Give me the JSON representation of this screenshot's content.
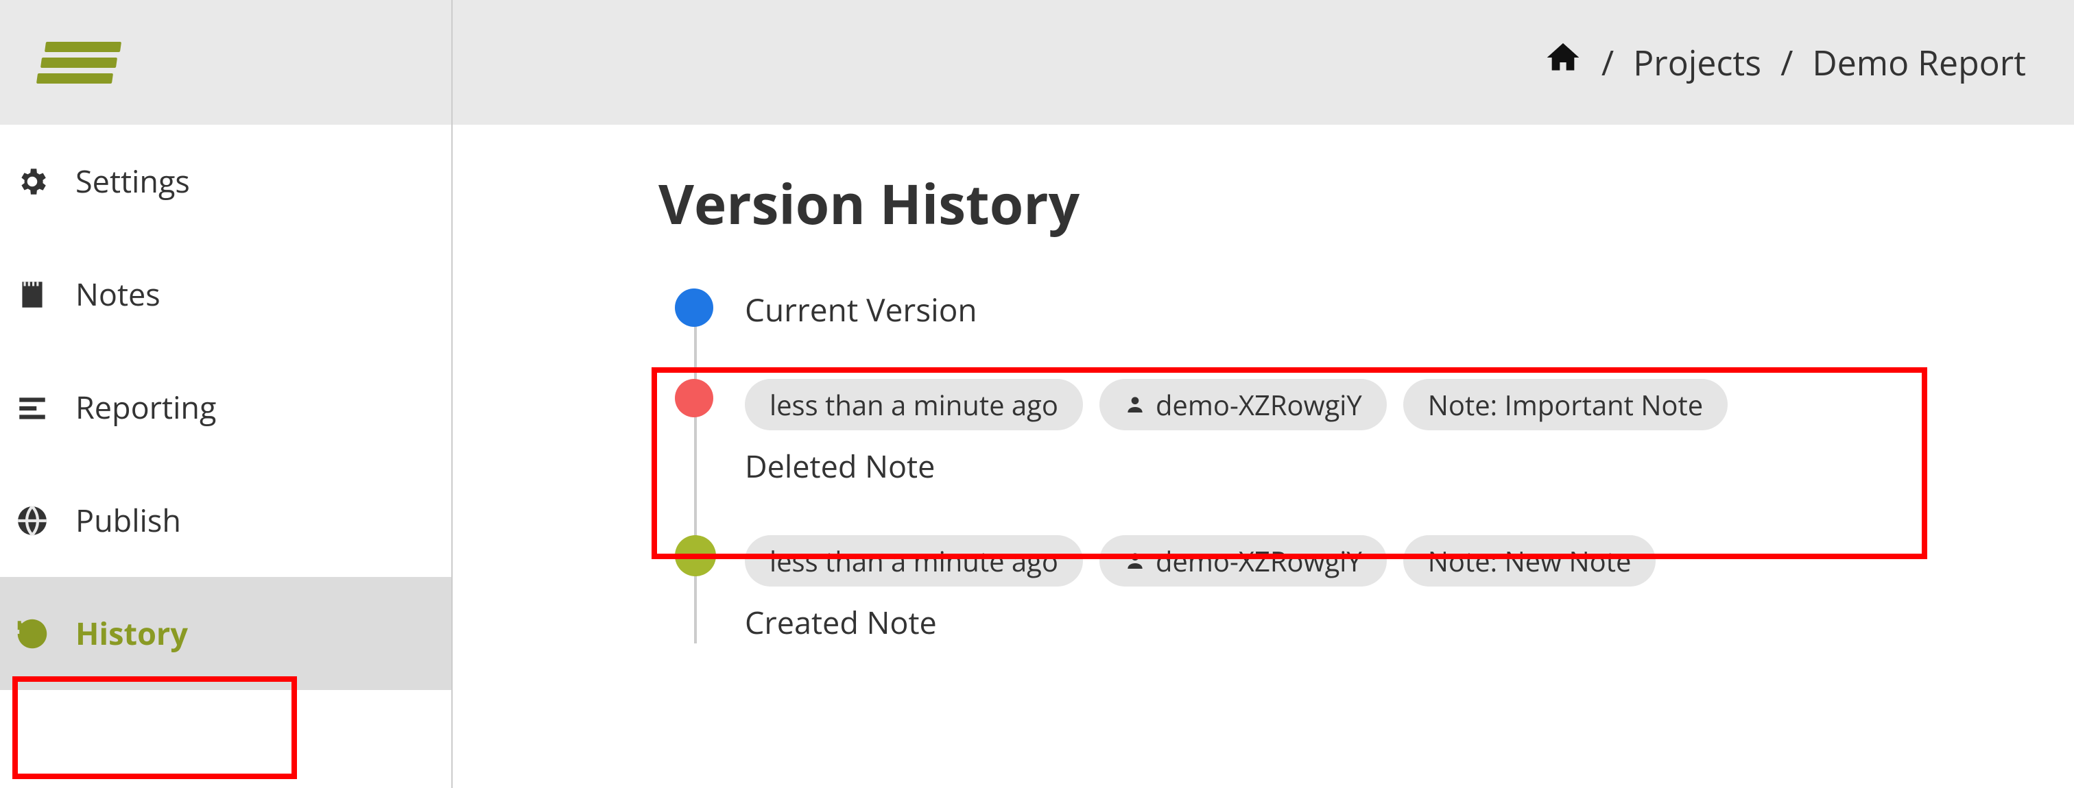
{
  "sidebar": {
    "items": [
      {
        "label": "Settings",
        "icon": "gear-icon",
        "active": false
      },
      {
        "label": "Notes",
        "icon": "notes-icon",
        "active": false
      },
      {
        "label": "Reporting",
        "icon": "report-icon",
        "active": false
      },
      {
        "label": "Publish",
        "icon": "globe-icon",
        "active": false
      },
      {
        "label": "History",
        "icon": "history-icon",
        "active": true
      }
    ]
  },
  "breadcrumb": {
    "projects": "Projects",
    "current": "Demo Report"
  },
  "page": {
    "title": "Version History"
  },
  "timeline": [
    {
      "dot": "blue",
      "title": "Current Version",
      "chips": [],
      "highlighted": false
    },
    {
      "dot": "red",
      "title": "Deleted Note",
      "chips": [
        {
          "type": "time",
          "text": "less than a minute ago"
        },
        {
          "type": "user",
          "text": "demo-XZRowgiY"
        },
        {
          "type": "note",
          "text": "Note: Important Note"
        }
      ],
      "highlighted": true
    },
    {
      "dot": "green",
      "title": "Created Note",
      "chips": [
        {
          "type": "time",
          "text": "less than a minute ago"
        },
        {
          "type": "user",
          "text": "demo-XZRowgiY"
        },
        {
          "type": "note",
          "text": "Note: New Note"
        }
      ],
      "highlighted": false
    }
  ]
}
